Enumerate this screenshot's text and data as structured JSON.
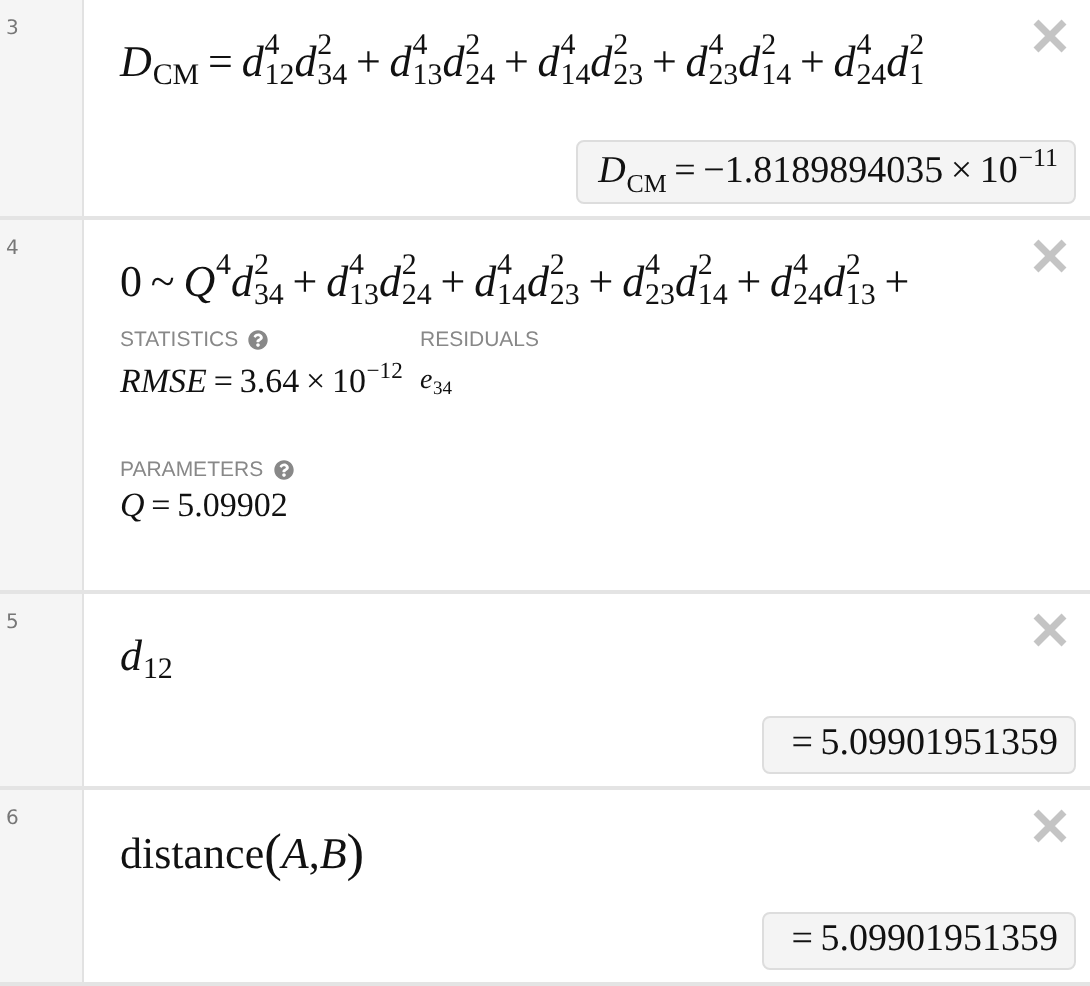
{
  "expressions": [
    {
      "number": "3",
      "latex": [
        {
          "kind": "var",
          "text": "D",
          "sub": "CM"
        },
        {
          "kind": "op",
          "text": "="
        },
        {
          "kind": "var",
          "text": "d",
          "sub": "12",
          "sup": "4"
        },
        {
          "kind": "var",
          "text": "d",
          "sub": "34",
          "sup": "2"
        },
        {
          "kind": "op",
          "text": "+"
        },
        {
          "kind": "var",
          "text": "d",
          "sub": "13",
          "sup": "4"
        },
        {
          "kind": "var",
          "text": "d",
          "sub": "24",
          "sup": "2"
        },
        {
          "kind": "op",
          "text": "+"
        },
        {
          "kind": "var",
          "text": "d",
          "sub": "14",
          "sup": "4"
        },
        {
          "kind": "var",
          "text": "d",
          "sub": "23",
          "sup": "2"
        },
        {
          "kind": "op",
          "text": "+"
        },
        {
          "kind": "var",
          "text": "d",
          "sub": "23",
          "sup": "4"
        },
        {
          "kind": "var",
          "text": "d",
          "sub": "14",
          "sup": "2"
        },
        {
          "kind": "op",
          "text": "+"
        },
        {
          "kind": "var",
          "text": "d",
          "sub": "24",
          "sup": "4"
        },
        {
          "kind": "var",
          "text": "d",
          "sub": "1",
          "sup": "2"
        }
      ],
      "output": [
        {
          "kind": "var",
          "text": "D",
          "sub": "CM"
        },
        {
          "kind": "op",
          "text": "="
        },
        {
          "kind": "text",
          "text": "−1.8189894035"
        },
        {
          "kind": "op",
          "text": "×"
        },
        {
          "kind": "text",
          "text": "10",
          "sup": "−11"
        }
      ]
    },
    {
      "number": "4",
      "latex": [
        {
          "kind": "text",
          "text": "0"
        },
        {
          "kind": "op",
          "text": "~"
        },
        {
          "kind": "var",
          "text": "Q",
          "sup": "4"
        },
        {
          "kind": "var",
          "text": "d",
          "sub": "34",
          "sup": "2"
        },
        {
          "kind": "op",
          "text": "+"
        },
        {
          "kind": "var",
          "text": "d",
          "sub": "13",
          "sup": "4"
        },
        {
          "kind": "var",
          "text": "d",
          "sub": "24",
          "sup": "2"
        },
        {
          "kind": "op",
          "text": "+"
        },
        {
          "kind": "var",
          "text": "d",
          "sub": "14",
          "sup": "4"
        },
        {
          "kind": "var",
          "text": "d",
          "sub": "23",
          "sup": "2"
        },
        {
          "kind": "op",
          "text": "+"
        },
        {
          "kind": "var",
          "text": "d",
          "sub": "23",
          "sup": "4"
        },
        {
          "kind": "var",
          "text": "d",
          "sub": "14",
          "sup": "2"
        },
        {
          "kind": "op",
          "text": "+"
        },
        {
          "kind": "var",
          "text": "d",
          "sub": "24",
          "sup": "4"
        },
        {
          "kind": "var",
          "text": "d",
          "sub": "13",
          "sup": "2"
        },
        {
          "kind": "op",
          "text": "+"
        }
      ],
      "regression": {
        "statistics_label": "STATISTICS",
        "residuals_label": "RESIDUALS",
        "statistics": [
          {
            "kind": "var",
            "text": "RMSE"
          },
          {
            "kind": "op",
            "text": "="
          },
          {
            "kind": "text",
            "text": "3.64"
          },
          {
            "kind": "op",
            "text": "×"
          },
          {
            "kind": "text",
            "text": "10",
            "sup": "−12"
          }
        ],
        "residuals": [
          {
            "kind": "var",
            "text": "e",
            "sub": "34"
          }
        ],
        "parameters_label": "PARAMETERS",
        "parameters": [
          {
            "kind": "var",
            "text": "Q"
          },
          {
            "kind": "op",
            "text": "="
          },
          {
            "kind": "text",
            "text": "5.09902"
          }
        ]
      }
    },
    {
      "number": "5",
      "latex": [
        {
          "kind": "var",
          "text": "d",
          "sub": "12"
        }
      ],
      "output": [
        {
          "kind": "op",
          "text": "="
        },
        {
          "kind": "text",
          "text": "5.09901951359"
        }
      ]
    },
    {
      "number": "6",
      "latex": [
        {
          "kind": "text",
          "text": "distance"
        },
        {
          "kind": "paren",
          "text": "("
        },
        {
          "kind": "var",
          "text": "A"
        },
        {
          "kind": "text",
          "text": ","
        },
        {
          "kind": "var",
          "text": "B"
        },
        {
          "kind": "paren",
          "text": ")"
        }
      ],
      "output": [
        {
          "kind": "op",
          "text": "="
        },
        {
          "kind": "text",
          "text": "5.09901951359"
        }
      ]
    }
  ]
}
